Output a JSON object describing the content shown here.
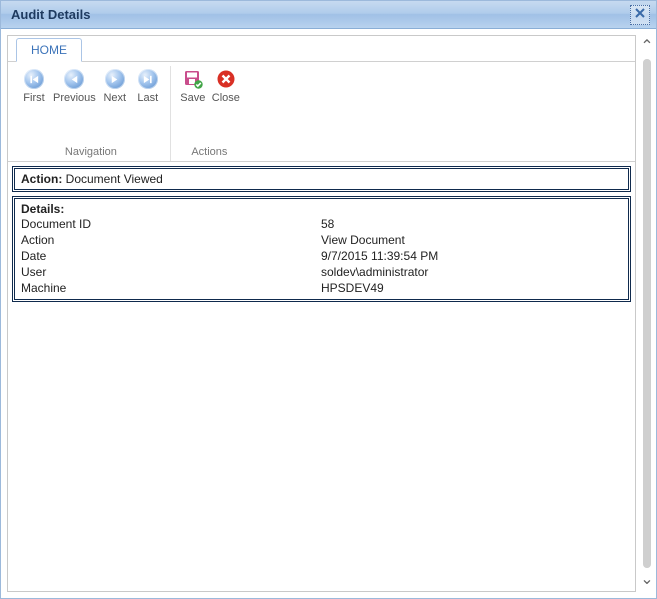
{
  "window": {
    "title": "Audit Details"
  },
  "ribbon": {
    "tabs": [
      {
        "label": "HOME",
        "active": true
      }
    ],
    "groups": {
      "navigation": {
        "label": "Navigation",
        "buttons": {
          "first": "First",
          "previous": "Previous",
          "next": "Next",
          "last": "Last"
        }
      },
      "actions": {
        "label": "Actions",
        "buttons": {
          "save": "Save",
          "close": "Close"
        }
      }
    }
  },
  "action_panel": {
    "label": "Action:",
    "value": "Document Viewed"
  },
  "details_panel": {
    "header": "Details:",
    "rows": [
      {
        "label": "Document ID",
        "value": "58"
      },
      {
        "label": "Action",
        "value": "View Document"
      },
      {
        "label": "Date",
        "value": "9/7/2015 11:39:54 PM"
      },
      {
        "label": "User",
        "value": "soldev\\administrator"
      },
      {
        "label": "Machine",
        "value": "HPSDEV49"
      }
    ]
  }
}
